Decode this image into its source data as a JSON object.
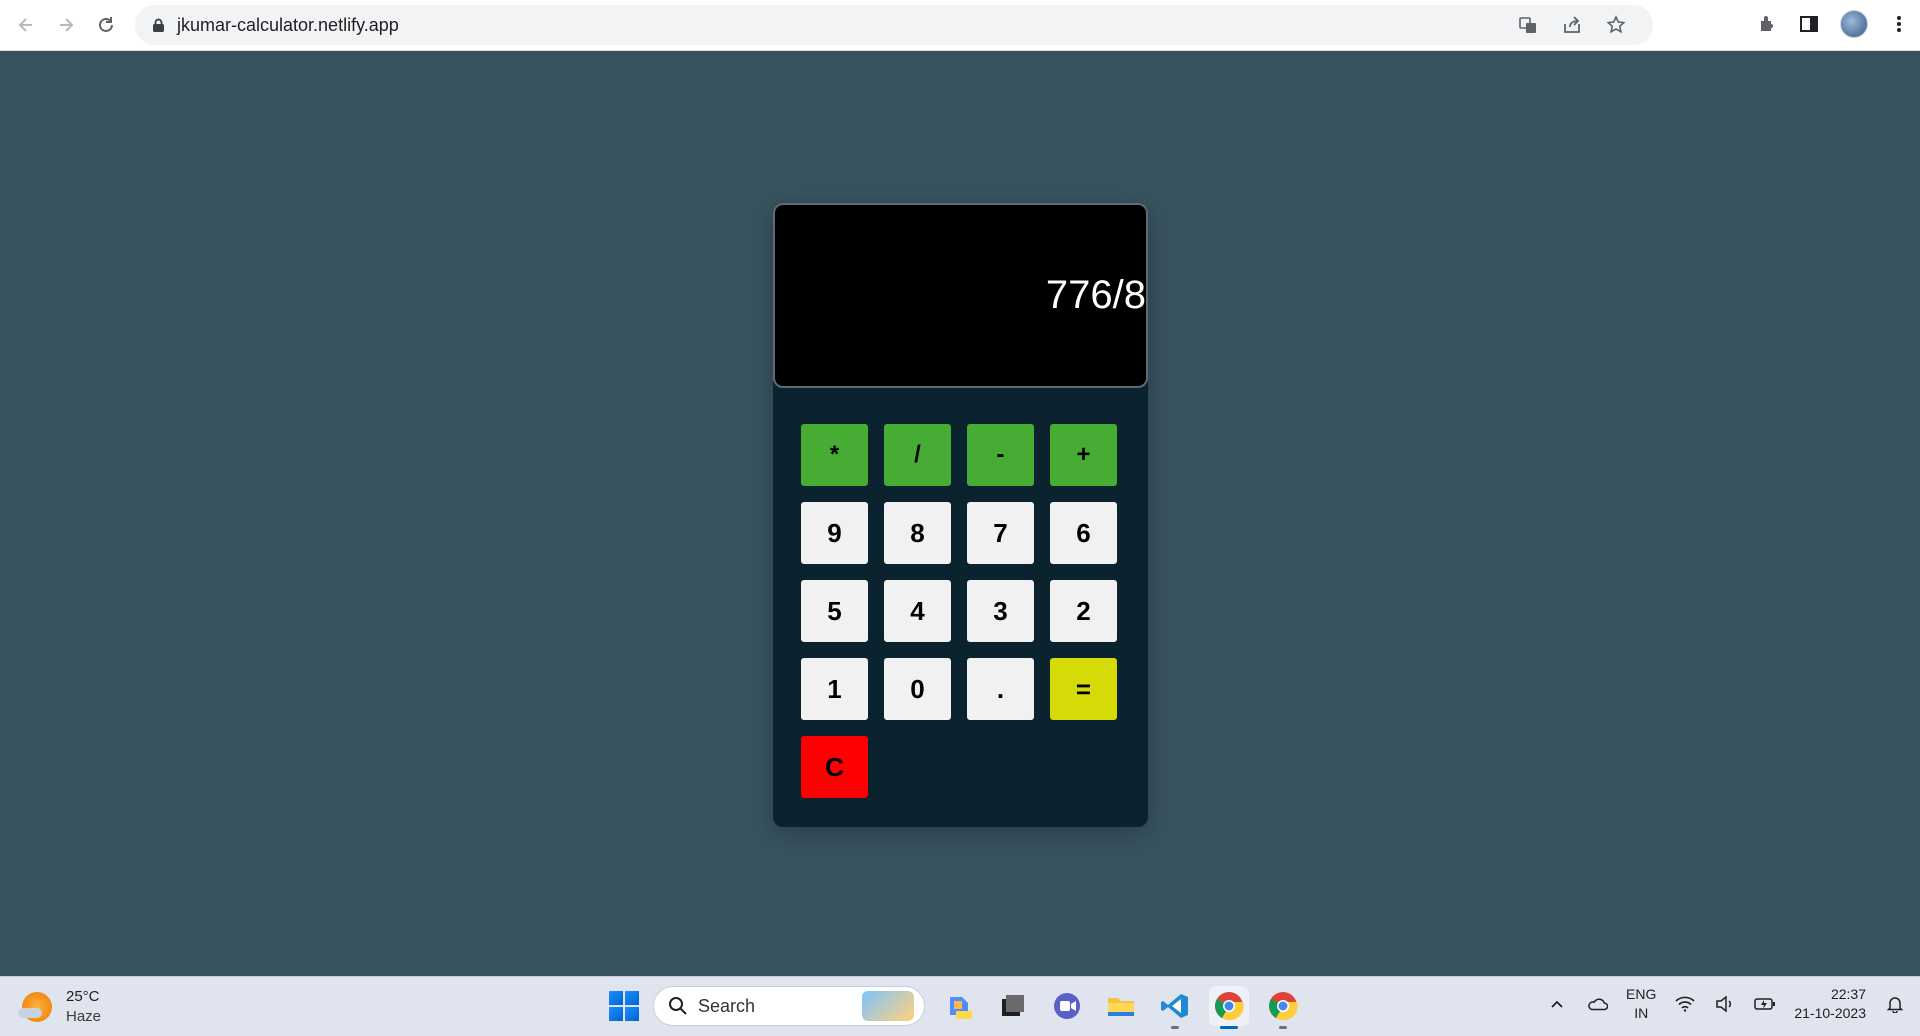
{
  "browser": {
    "url": "jkumar-calculator.netlify.app",
    "icons": [
      "back-icon",
      "forward-icon",
      "reload-icon",
      "lock-icon",
      "translate-icon",
      "share-icon",
      "bookmark-star-icon",
      "extensions-icon",
      "side-panel-icon",
      "profile-avatar",
      "kebab-menu-icon"
    ]
  },
  "calculator": {
    "display": "776/8",
    "keys": [
      {
        "label": "*",
        "kind": "op"
      },
      {
        "label": "/",
        "kind": "op"
      },
      {
        "label": "-",
        "kind": "op"
      },
      {
        "label": "+",
        "kind": "op"
      },
      {
        "label": "9",
        "kind": "num"
      },
      {
        "label": "8",
        "kind": "num"
      },
      {
        "label": "7",
        "kind": "num"
      },
      {
        "label": "6",
        "kind": "num"
      },
      {
        "label": "5",
        "kind": "num"
      },
      {
        "label": "4",
        "kind": "num"
      },
      {
        "label": "3",
        "kind": "num"
      },
      {
        "label": "2",
        "kind": "num"
      },
      {
        "label": "1",
        "kind": "num"
      },
      {
        "label": "0",
        "kind": "num"
      },
      {
        "label": ".",
        "kind": "num"
      },
      {
        "label": "=",
        "kind": "eq"
      },
      {
        "label": "C",
        "kind": "clear"
      }
    ],
    "colors": {
      "operator": "#47ac34",
      "number": "#f1f1f1",
      "equals": "#d6db08",
      "clear": "#ff0000",
      "body": "#0b232e",
      "display": "#000000",
      "page": "#38535f"
    }
  },
  "taskbar": {
    "weather": {
      "temp": "25°C",
      "condition": "Haze"
    },
    "search_label": "Search",
    "lang": {
      "line1": "ENG",
      "line2": "IN"
    },
    "clock": {
      "time": "22:37",
      "date": "21-10-2023"
    }
  }
}
